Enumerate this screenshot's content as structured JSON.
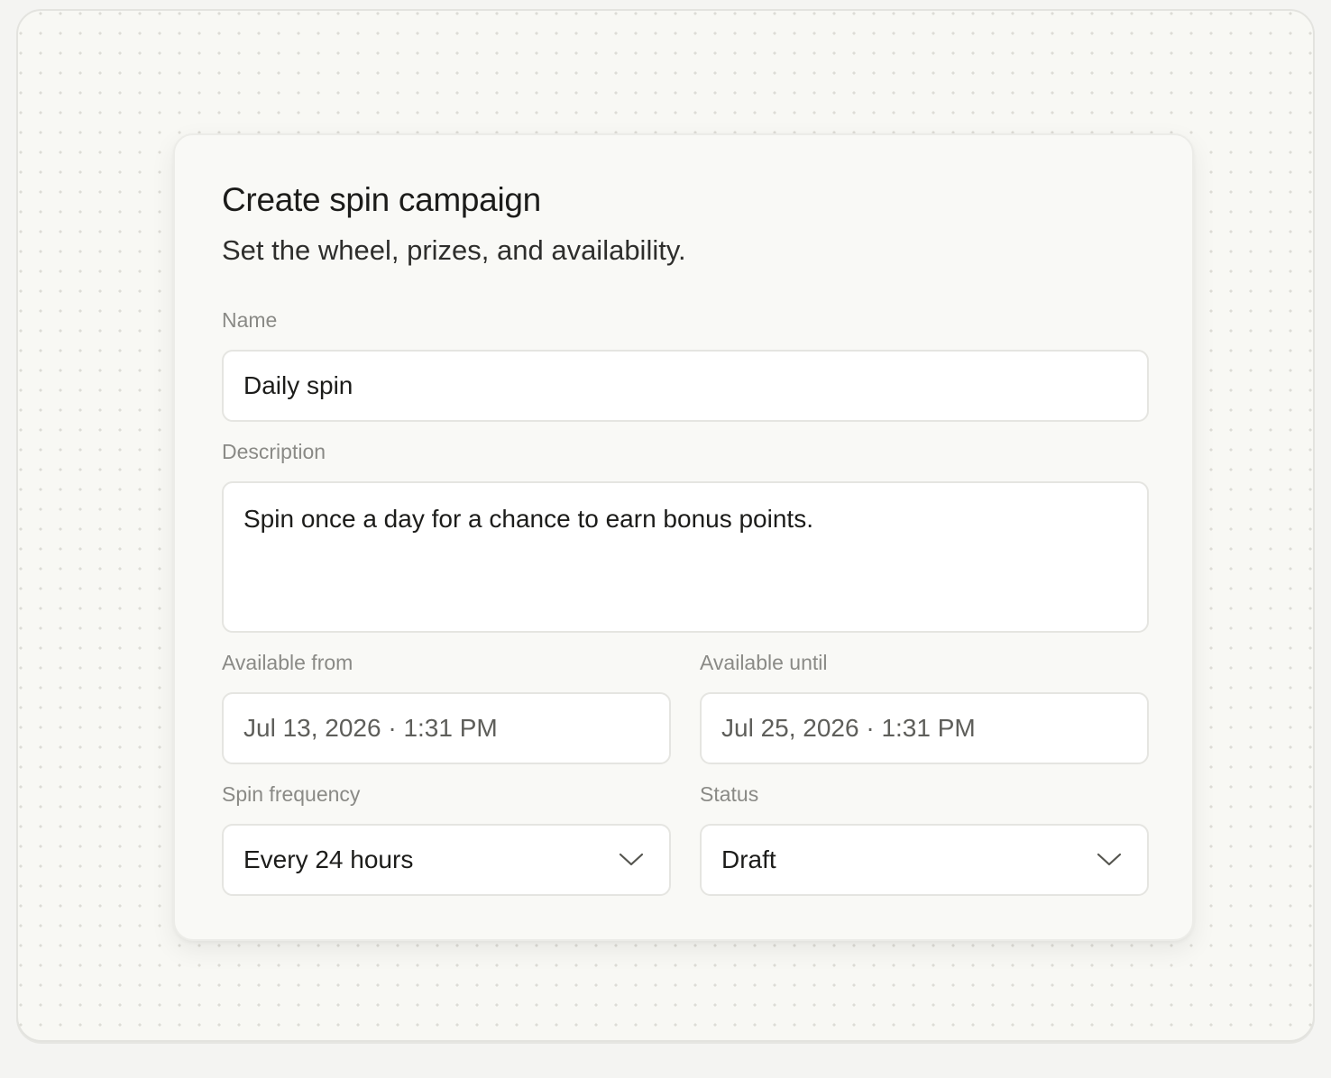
{
  "dialog": {
    "title": "Create spin campaign",
    "subtitle": "Set the wheel, prizes, and availability."
  },
  "form": {
    "name": {
      "label": "Name",
      "value": "Daily spin"
    },
    "description": {
      "label": "Description",
      "value": "Spin once a day for a chance to earn bonus points."
    },
    "available_from": {
      "label": "Available from",
      "value": "Jul 13, 2026 · 1:31 PM"
    },
    "available_until": {
      "label": "Available until",
      "value": "Jul 25, 2026 · 1:31 PM"
    },
    "spin_frequency": {
      "label": "Spin frequency",
      "value": "Every 24 hours",
      "icon": "chevron-down-icon"
    },
    "status": {
      "label": "Status",
      "value": "Draft",
      "icon": "chevron-down-icon"
    }
  },
  "colors": {
    "background": "#f8f8f4",
    "card": "#f9f9f6",
    "input": "#ffffff",
    "label": "#8a8a86",
    "text": "#1c1c1a"
  }
}
